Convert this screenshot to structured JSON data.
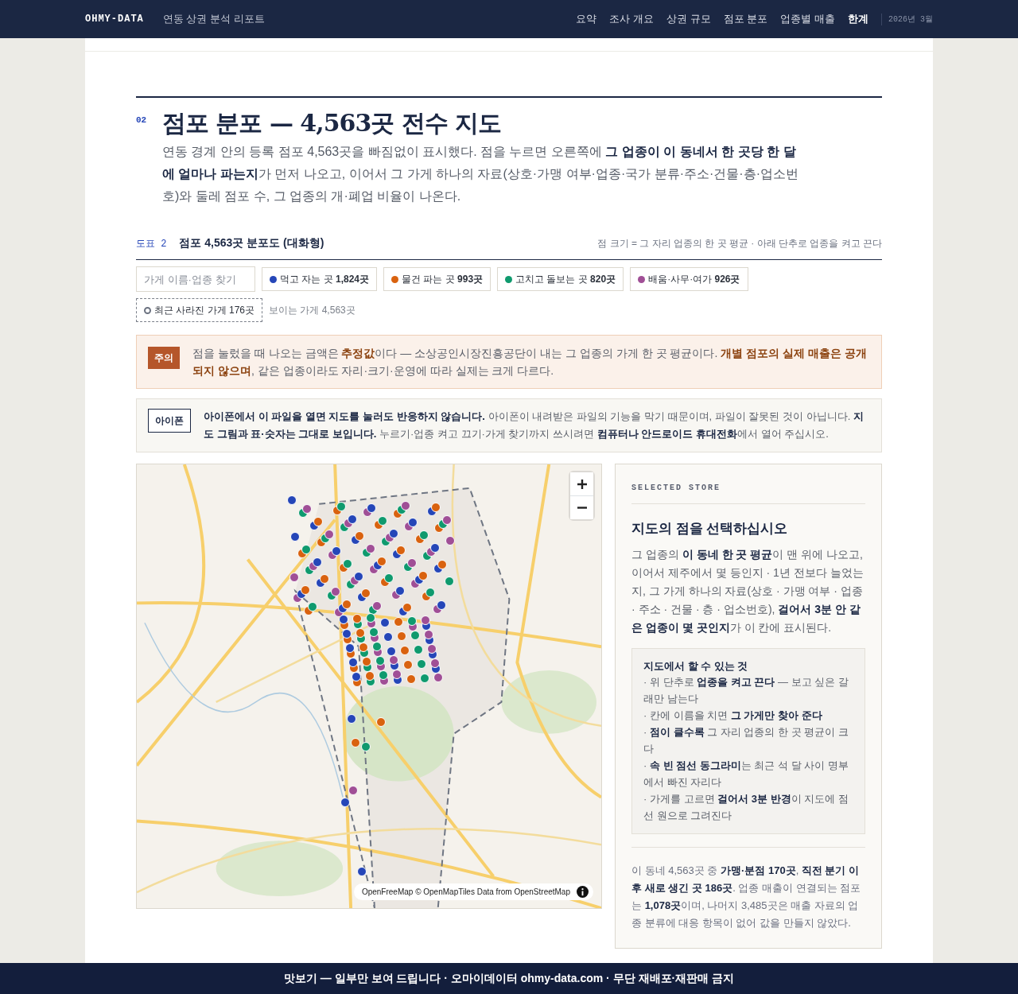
{
  "navbar": {
    "brand": "OHMY-DATA",
    "subtitle": "연동 상권 분석 리포트",
    "links": [
      {
        "label": "요약",
        "selected": false
      },
      {
        "label": "조사 개요",
        "selected": false
      },
      {
        "label": "상권 규모",
        "selected": false
      },
      {
        "label": "점포 분포",
        "selected": false
      },
      {
        "label": "업종별 매출",
        "selected": false
      },
      {
        "label": "한계",
        "selected": true
      }
    ],
    "date": "2026년 3월"
  },
  "section": {
    "number": "02",
    "title": "점포 분포 — 4,563곳 전수 지도",
    "intro": "연동 경계 안의 등록 점포 4,563곳을 빠짐없이 표시했다. 점을 누르면 오른쪽에 **그 업종이 이 동네서 한 곳당 한 달에 얼마나 파는지**가 먼저 나오고, 이어서 그 가게 하나의 자료(상호·가맹 여부·업종·국가 분류·주소·건물·층·업소번호)와 둘레 점포 수, 그 업종의 개·폐업 비율이 나온다."
  },
  "figure": {
    "label": "도표 2",
    "title": "점포 4,563곳 분포도 (대화형)",
    "note": "점 크기 = 그 자리 업종의 한 곳 평균 · 아래 단추로 업종을 켜고 끈다"
  },
  "search": {
    "placeholder": "가게 이름·업종 찾기"
  },
  "legend": [
    {
      "label": "먹고 자는 곳 **1,824곳**",
      "color": "#2546b8"
    },
    {
      "label": "물건 파는 곳 **993곳**",
      "color": "#d9620f"
    },
    {
      "label": "고치고 돌보는 곳 **820곳**",
      "color": "#0f9a6e"
    },
    {
      "label": "배움·사무·여가 **926곳**",
      "color": "#a04f96"
    }
  ],
  "closed_toggle": {
    "label": "최근 사라진 가게 176곳"
  },
  "visible_count": "보이는 가게 4,563곳",
  "notices": [
    {
      "kind": "warning",
      "badge": "주의",
      "text": "점을 눌렀을 때 나오는 금액은 **추정값**이다 — 소상공인시장진흥공단이 내는 그 업종의 가게 한 곳 평균이다. **개별 점포의 실제 매출은 공개되지 않으며**, 같은 업종이라도 자리·크기·운영에 따라 실제는 크게 다르다."
    },
    {
      "kind": "info",
      "badge": "아이폰",
      "text": "**아이폰에서 이 파일을 열면 지도를 눌러도 반응하지 않습니다.** 아이폰이 내려받은 파일의 기능을 막기 때문이며, 파일이 잘못된 것이 아닙니다. **지도 그림과 표·숫자는 그대로 보입니다.** 누르기·업종 켜고 끄기·가게 찾기까지 쓰시려면 **컴퓨터나 안드로이드 휴대전화**에서 열어 주십시오."
    }
  ],
  "map": {
    "kind": "picture",
    "attribution": "OpenFreeMap © OpenMapTiles Data from OpenStreetMap"
  },
  "panel": {
    "eyebrow": "SELECTED STORE",
    "title": "지도의 점을 선택하십시오",
    "text": "그 업종의 **이 동네 한 곳 평균**이 맨 위에 나오고, 이어서 제주에서 몇 등인지 · 1년 전보다 늘었는지, 그 가게 하나의 자료(상호 · 가맹 여부 · 업종 · 주소 · 건물 · 층 · 업소번호), **걸어서 3분 안 같은 업종이 몇 곳인지**가 이 칸에 표시된다.",
    "tips": {
      "title": "지도에서 할 수 있는 것",
      "items": [
        "· 위 단추로 **업종을 켜고 끈다** — 보고 싶은 갈래만 남는다",
        "· 칸에 이름을 치면 **그 가게만 찾아 준다**",
        "· **점이 클수록** 그 자리 업종의 한 곳 평균이 크다",
        "· **속 빈 점선 동그라미**는 최근 석 달 사이 명부에서 빠진 자리다",
        "· 가게를 고르면 **걸어서 3분 반경**이 지도에 점선 원으로 그려진다"
      ]
    },
    "summary": "이 동네 4,563곳 중 **가맹·분점 170곳**, **직전 분기 이후 새로 생긴 곳 186곳**. 업종 매출이 연결되는 점포는 **1,078곳**이며, 나머지 3,485곳은 매출 자료의 업종 분류에 대응 항목이 없어 값을 만들지 않았다."
  },
  "footer": "맛보기 — 일부만 보여 드립니다 · 오마이데이터 ohmy-data.com · 무단 재배포·재판매 금지"
}
